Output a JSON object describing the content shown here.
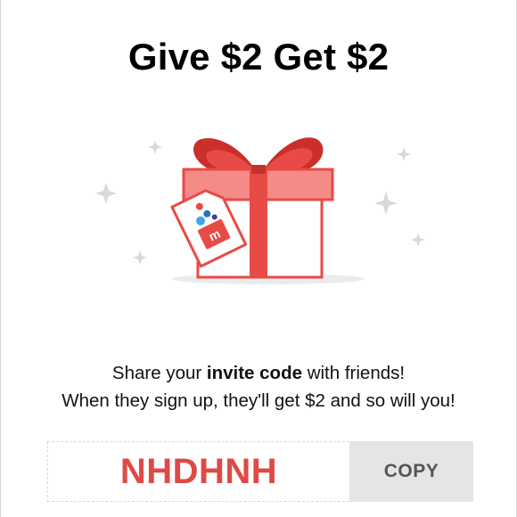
{
  "title": "Give $2 Get $2",
  "message": {
    "line1_prefix": "Share your ",
    "line1_bold": "invite code",
    "line1_suffix": " with friends!",
    "line2": "When they sign up, they'll get $2 and so will you!"
  },
  "invite_code": "NHDHNH",
  "copy_label": "COPY",
  "illustration": {
    "icon": "gift-box-icon",
    "tag_icon": "gift-tag-icon",
    "logo_letter": "m",
    "colors": {
      "red": "#e84a45",
      "light_red": "#f48b86",
      "sparkle": "#d9d9d9"
    }
  }
}
